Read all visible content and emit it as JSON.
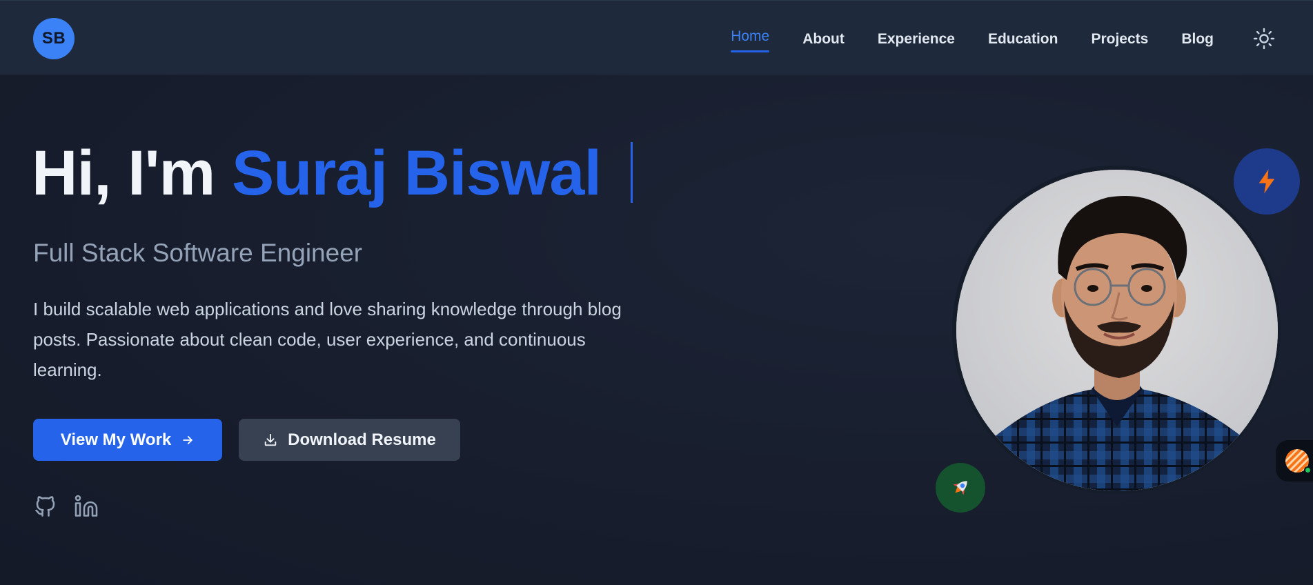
{
  "logo": {
    "initials": "SB"
  },
  "nav": {
    "items": [
      {
        "label": "Home",
        "active": true
      },
      {
        "label": "About"
      },
      {
        "label": "Experience"
      },
      {
        "label": "Education"
      },
      {
        "label": "Projects"
      },
      {
        "label": "Blog"
      }
    ],
    "theme_toggle_icon": "sun-icon"
  },
  "hero": {
    "greeting": "Hi, I'm ",
    "name": "Suraj Biswal",
    "subtitle": "Full Stack Software Engineer",
    "bio": "I build scalable web applications and love sharing knowledge through blog posts. Passionate about clean code, user experience, and continuous learning.",
    "primary_button": {
      "label": "View My Work",
      "icon": "arrow-right-icon"
    },
    "secondary_button": {
      "label": "Download Resume",
      "icon": "download-icon"
    },
    "social": [
      {
        "icon": "github-icon"
      },
      {
        "icon": "linkedin-icon"
      }
    ]
  },
  "profile": {
    "badges": [
      {
        "icon": "lightning-bolt-icon",
        "color": "#1e3a8a"
      },
      {
        "icon": "rocket-icon",
        "color": "#14532d"
      }
    ]
  },
  "chat_widget": {
    "icon": "chat-avatar-icon",
    "status_color": "#22c55e"
  },
  "colors": {
    "accent": "#2563eb",
    "navbar_bg": "#1e293b",
    "page_bg": "#181f2f",
    "secondary_button_bg": "#374151"
  }
}
